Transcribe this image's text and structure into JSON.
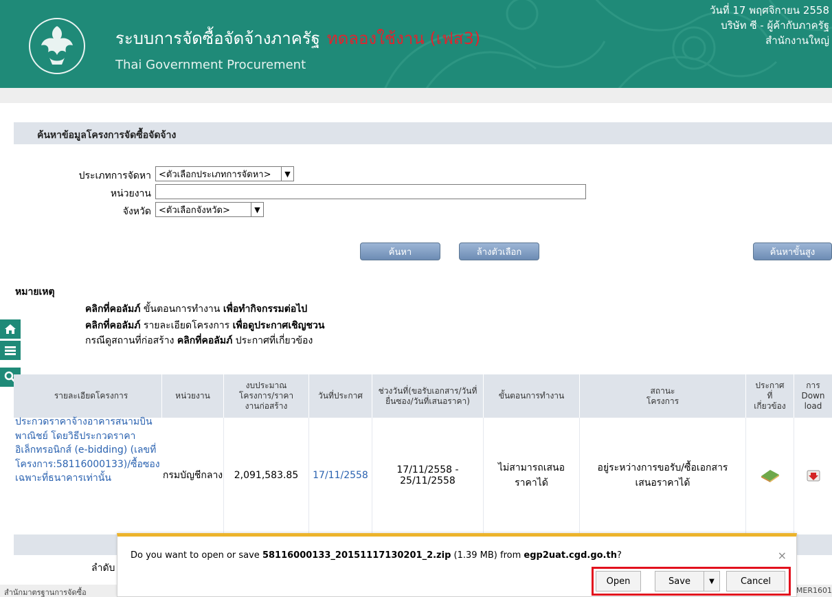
{
  "header": {
    "title_th": "ระบบการจัดซื้อจัดจ้างภาครัฐ",
    "title_test": "ทดลองใช้งาน (เฟส3)",
    "title_en": "Thai Government Procurement",
    "date": "วันที่ 17 พฤศจิกายน 2558",
    "company": "บริษัท ซี - ผู้ค้ากับภาครัฐ",
    "branch": "สำนักงานใหญ่"
  },
  "search": {
    "panel_title": "ค้นหาข้อมูลโครงการจัดซื้อจัดจ้าง",
    "method_label": "ประเภทการจัดหา",
    "method_value": "<ตัวเลือกประเภทการจัดหา>",
    "agency_label": "หน่วยงาน",
    "agency_value": "",
    "province_label": "จังหวัด",
    "province_value": "<ตัวเลือกจังหวัด>",
    "search_button": "ค้นหา",
    "clear_button": "ล้างตัวเลือก",
    "advanced_button": "ค้นหาขั้นสูง"
  },
  "notes": {
    "heading": "หมายเหตุ",
    "line1_a": "คลิกที่คอลัมภ์",
    "line1_b": "ขั้นตอนการทำงาน",
    "line1_c": "เพื่อทำกิจกรรมต่อไป",
    "line2_a": "คลิกที่คอลัมภ์",
    "line2_b": "รายละเอียดโครงการ",
    "line2_c": "เพื่อดูประกาศเชิญชวน",
    "line3_a": "กรณีดูสถานที่ก่อสร้าง",
    "line3_b": "คลิกที่คอลัมภ์",
    "line3_c": "ประกาศที่เกี่ยวข้อง"
  },
  "side_icons": [
    "home-icon",
    "menu-icon",
    "search-icon"
  ],
  "table": {
    "headers": {
      "detail": "รายละเอียดโครงการ",
      "agency": "หน่วยงาน",
      "budget": "งบประมาณโครงการ/ราคางานก่อสร้าง",
      "announce_date": "วันที่ประกาศ",
      "period": "ช่วงวันที่(ขอรับเอกสาร/วันที่ยื่นซอง/วันที่เสนอราคา)",
      "step": "ขั้นตอนการทำงาน",
      "status": "สถานะโครงการ",
      "related": "ประกาศที่เกี่ยวข้อง",
      "download": "การ Down load"
    },
    "row": {
      "detail": "ประกวดราคาจ้างอาคารสนามบินพาณิชย์ โดยวิธีประกวดราคาอิเล็กทรอนิกส์ (e-bidding) (เลขที่โครงการ:58116000133)/ซื้อซองเฉพาะที่ธนาคารเท่านั้น",
      "agency": "กรมบัญชีกลาง",
      "budget": "2,091,583.85",
      "announce_date": "17/11/2558",
      "period_start": "17/11/2558 -",
      "period_end": "25/11/2558",
      "step_1": "ไม่สามารถเสนอ",
      "step_2": "ราคาได้",
      "status_1": "อยู่ระหว่างการขอรับ/ซื้อเอกสาร",
      "status_2": "เสนอราคาได้"
    },
    "footer_text": "ลำดับ"
  },
  "bottom": {
    "left": "สำนักมาตรฐานการจัดซื้อ",
    "right": "MER1601"
  },
  "download_bar": {
    "msg_prefix": "Do you want to open or save ",
    "file_name": "58116000133_20151117130201_2.zip",
    "file_size": " (1.39 MB) from ",
    "host": "egp2uat.cgd.go.th",
    "msg_suffix": "?",
    "open": "Open",
    "save": "Save",
    "cancel": "Cancel"
  },
  "colors": {
    "header_teal": "#1f8a78",
    "test_red": "#e0242e",
    "link_blue": "#2a62b0",
    "table_head": "#dee3ea",
    "notification_accent": "#ecb32b",
    "highlight_red": "#e2111d"
  }
}
